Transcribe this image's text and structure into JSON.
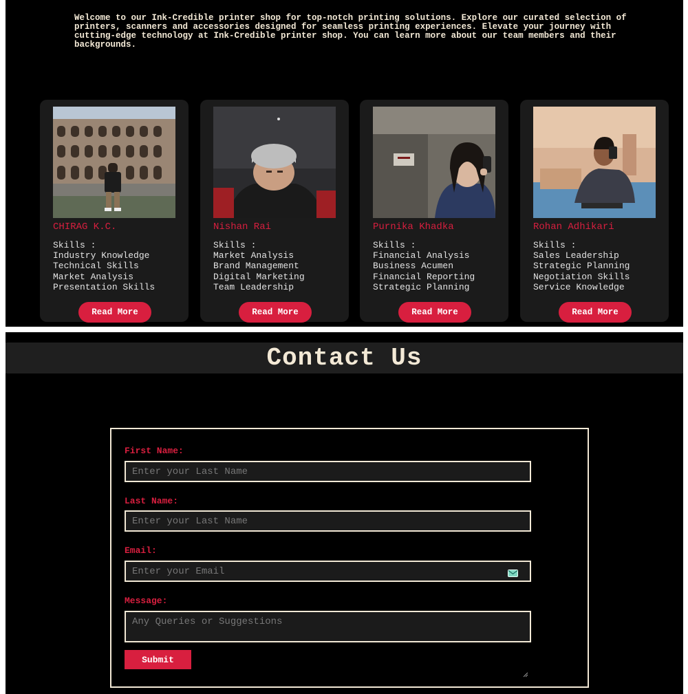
{
  "about": {
    "intro": "Welcome to our Ink-Credible printer shop for top-notch printing solutions. Explore our curated selection of printers, scanners and accessories designed for seamless printing experiences. Elevate your journey with cutting-edge technology at Ink-Credible printer shop. You can learn more about our team members and their backgrounds."
  },
  "team": [
    {
      "name": "CHIRAG K.C.",
      "skills_label": "Skills :",
      "skills": [
        "Industry Knowledge",
        "Technical Skills",
        "Market Analysis",
        "Presentation Skills"
      ],
      "button": "Read More"
    },
    {
      "name": "Nishan Rai",
      "skills_label": "Skills :",
      "skills": [
        "Market Analysis",
        "Brand Management",
        "Digital Marketing",
        "Team Leadership"
      ],
      "button": "Read More"
    },
    {
      "name": "Purnika Khadka",
      "skills_label": "Skills :",
      "skills": [
        "Financial Analysis",
        "Business Acumen",
        "Financial Reporting",
        "Strategic Planning"
      ],
      "button": "Read More"
    },
    {
      "name": "Rohan Adhikari",
      "skills_label": "Skills :",
      "skills": [
        "Sales Leadership",
        "Strategic Planning",
        "Negotiation Skills",
        "Service Knowledge"
      ],
      "button": "Read More"
    }
  ],
  "contact": {
    "title": "Contact Us",
    "first_name": {
      "label": "First Name:",
      "placeholder": "Enter your Last Name"
    },
    "last_name": {
      "label": "Last Name:",
      "placeholder": "Enter your Last Name"
    },
    "email": {
      "label": "Email:",
      "placeholder": "Enter your Email"
    },
    "message": {
      "label": "Message:",
      "placeholder": "Any Queries or Suggestions"
    },
    "submit": "Submit"
  },
  "colors": {
    "background": "#000000",
    "card": "#1b1b1b",
    "accent": "#d81f3f",
    "cream": "#f3e9d6",
    "text": "#e3e3e3"
  },
  "icons": {
    "email": "email-envelope-icon",
    "resize": "resize-grip-icon"
  }
}
